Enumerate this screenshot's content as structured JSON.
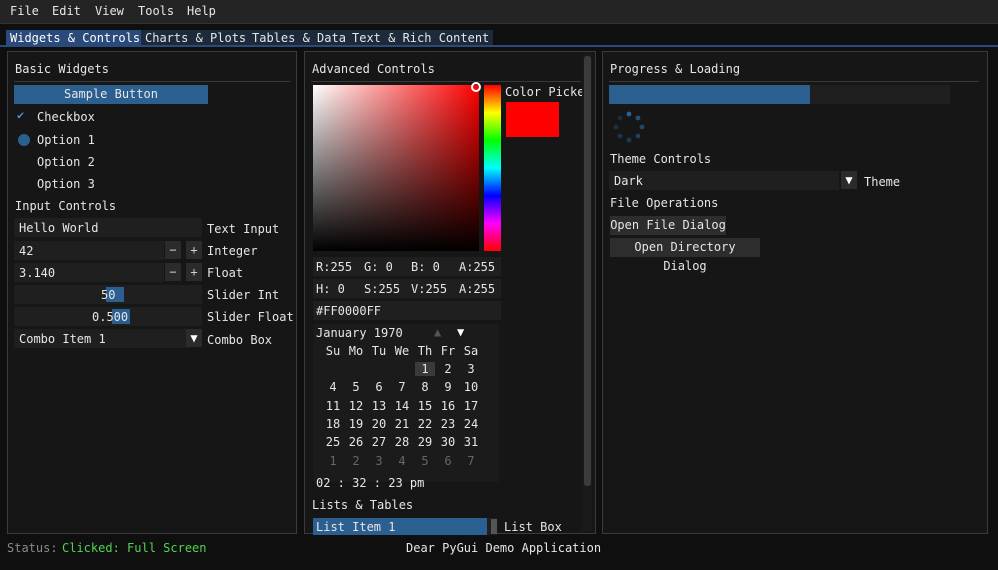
{
  "menu": [
    "File",
    "Edit",
    "View",
    "Tools",
    "Help"
  ],
  "tabs": [
    "Widgets & Controls",
    "Charts & Plots",
    "Tables & Data",
    "Text & Rich Content"
  ],
  "basic": {
    "title": "Basic Widgets",
    "sample_button": "Sample Button",
    "checkbox_label": "Checkbox",
    "radio": [
      "Option 1",
      "Option 2",
      "Option 3"
    ],
    "input_controls_title": "Input Controls",
    "text_input_value": "Hello World",
    "text_input_label": "Text Input",
    "int_value": "42",
    "int_label": "Integer",
    "float_value": "3.140",
    "float_label": "Float",
    "minus": "−",
    "plus": "+",
    "slider_int_value": "50",
    "slider_int_label": "Slider Int",
    "slider_float_value": "0.500",
    "slider_float_label": "Slider Float",
    "combo_value": "Combo Item 1",
    "combo_label": "Combo Box"
  },
  "advanced": {
    "title": "Advanced Controls",
    "color_picker_label": "Color Picke",
    "selected_color": "#FF0000",
    "rgba": [
      "R:255",
      "G:  0",
      "B:  0",
      "A:255"
    ],
    "hsva": [
      "H:  0",
      "S:255",
      "V:255",
      "A:255"
    ],
    "hex": "#FF0000FF",
    "month": "January 1970",
    "weekdays": [
      "Su",
      "Mo",
      "Tu",
      "We",
      "Th",
      "Fr",
      "Sa"
    ],
    "calendar": [
      [
        "",
        "",
        "",
        "",
        "1",
        "2",
        "3"
      ],
      [
        "4",
        "5",
        "6",
        "7",
        "8",
        "9",
        "10"
      ],
      [
        "11",
        "12",
        "13",
        "14",
        "15",
        "16",
        "17"
      ],
      [
        "18",
        "19",
        "20",
        "21",
        "22",
        "23",
        "24"
      ],
      [
        "25",
        "26",
        "27",
        "28",
        "29",
        "30",
        "31"
      ],
      [
        "1",
        "2",
        "3",
        "4",
        "5",
        "6",
        "7"
      ]
    ],
    "time": "02 : 32 : 23 pm",
    "lists_title": "Lists & Tables",
    "list_item": "List Item 1",
    "list_label": "List Box"
  },
  "progress": {
    "title": "Progress & Loading",
    "progress_fraction": 0.59,
    "theme_title": "Theme Controls",
    "theme_value": "Dark",
    "theme_label": "Theme",
    "file_title": "File Operations",
    "open_file": "Open File Dialog",
    "open_dir": "Open Directory Dialog"
  },
  "status": {
    "label": "Status:",
    "value": "Clicked: Full Screen",
    "app_title": "Dear PyGui Demo Application"
  },
  "colors": {
    "accent": "#2a5f8f",
    "status_green": "#52d352",
    "selected": "#ff0000"
  }
}
